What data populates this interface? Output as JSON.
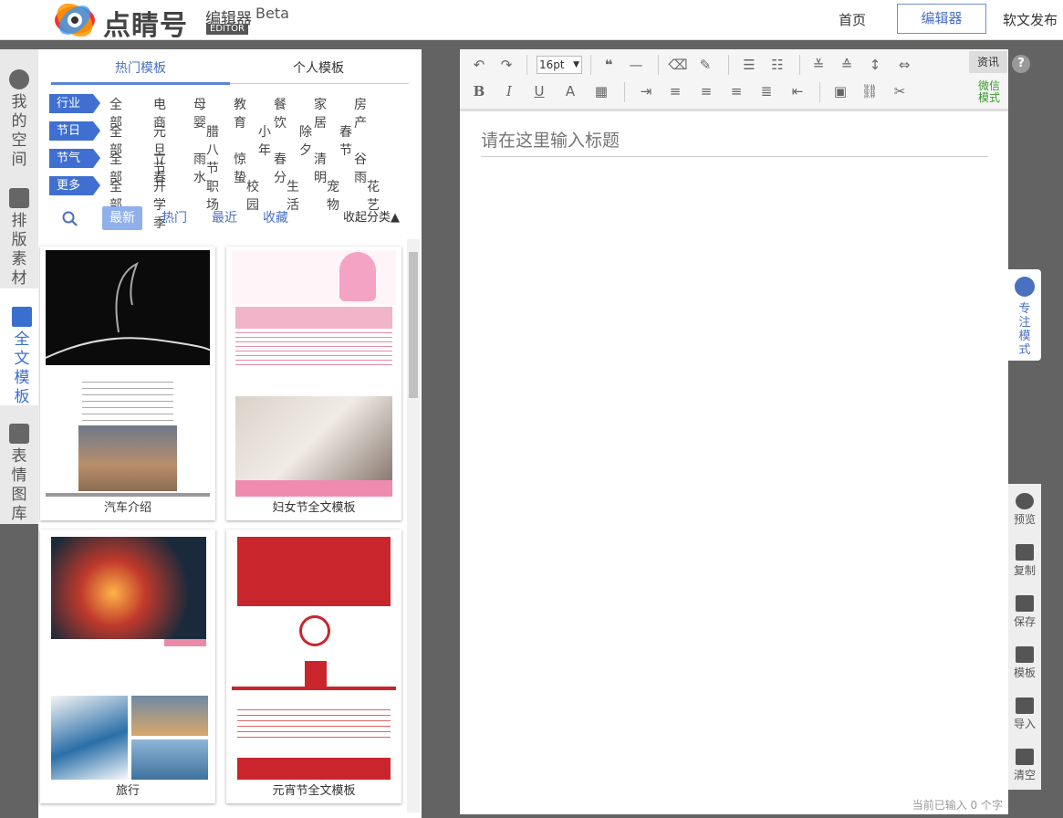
{
  "header": {
    "logo_text": "点睛号",
    "logo_sub": "编辑器",
    "logo_editor": "EDITOR",
    "logo_beta": "Beta",
    "nav": [
      "首页",
      "编辑器",
      "软文发布"
    ]
  },
  "sidebar": {
    "items": [
      {
        "label": "我的空间",
        "icon": "user-icon"
      },
      {
        "label": "排版素材",
        "icon": "layers-icon"
      },
      {
        "label": "全文模板",
        "icon": "template-icon"
      },
      {
        "label": "表情图库",
        "icon": "image-icon"
      }
    ]
  },
  "panel": {
    "tabs": [
      "热门模板",
      "个人模板"
    ],
    "categories": [
      {
        "tag": "行业",
        "items": [
          "全部",
          "电商",
          "母婴",
          "教育",
          "餐饮",
          "家居",
          "房产"
        ]
      },
      {
        "tag": "节日",
        "items": [
          "全部",
          "元旦节",
          "腊八节",
          "小年",
          "除夕",
          "春节"
        ]
      },
      {
        "tag": "节气",
        "items": [
          "全部",
          "立春",
          "雨水",
          "惊蛰",
          "春分",
          "清明",
          "谷雨"
        ]
      },
      {
        "tag": "更多",
        "items": [
          "全部",
          "开学季",
          "职场",
          "校园",
          "生活",
          "宠物",
          "花艺"
        ]
      }
    ],
    "filters": [
      "最新",
      "热门",
      "最近",
      "收藏"
    ],
    "collapse": "收起分类▲",
    "cards": [
      "汽车介绍",
      "妇女节全文模板",
      "旅行",
      "元宵节全文模板"
    ]
  },
  "editor": {
    "title_placeholder": "请在这里输入标题",
    "fontsize": "16pt",
    "news": "资讯",
    "wechat_mode": "微信模式",
    "wordcount": "当前已输入 0 个字"
  },
  "focus": "专注模式",
  "rtools": [
    "预览",
    "复制",
    "保存",
    "模板",
    "导入",
    "清空"
  ],
  "help": "?"
}
